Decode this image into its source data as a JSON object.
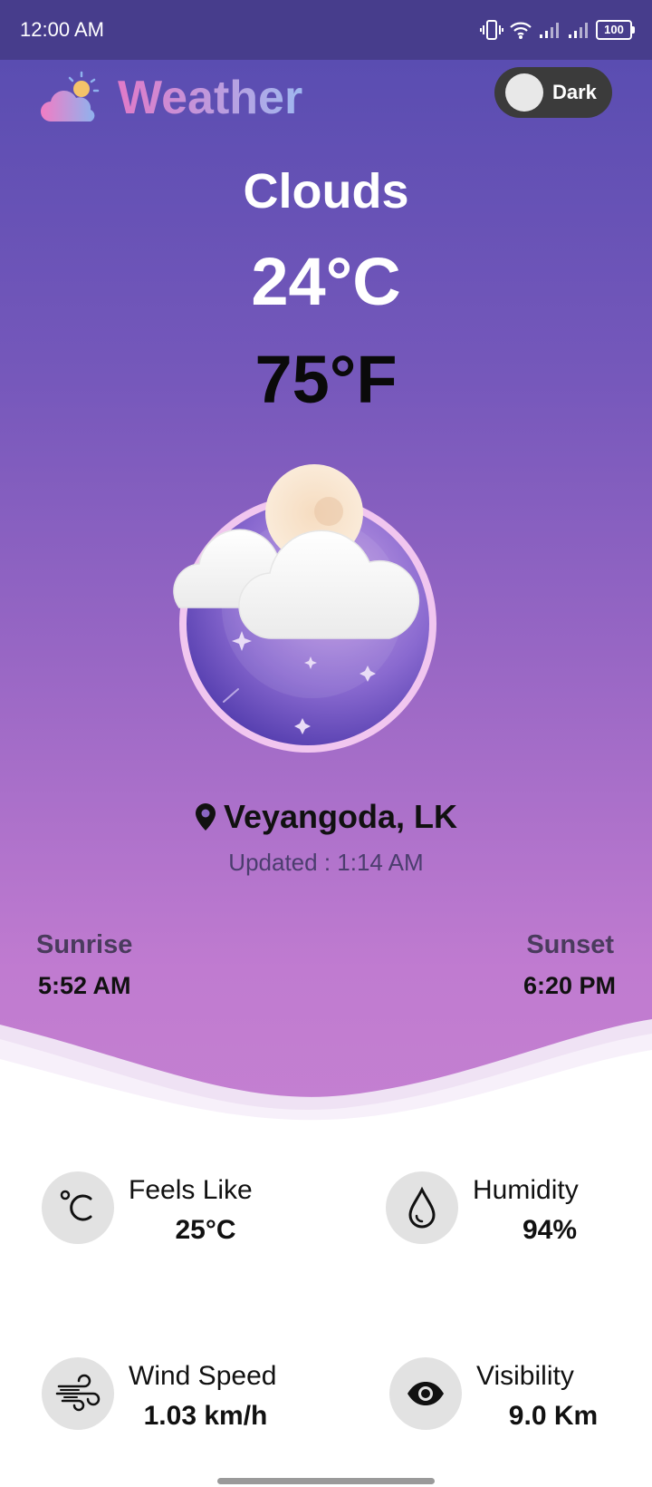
{
  "status_bar": {
    "time": "12:00 AM",
    "battery": "100"
  },
  "app": {
    "title": "Weather",
    "theme_toggle_label": "Dark"
  },
  "current": {
    "condition": "Clouds",
    "temp_c": "24°C",
    "temp_f": "75°F",
    "location": "Veyangoda, LK",
    "updated_label": "Updated :",
    "updated_time": "1:14 AM"
  },
  "sun": {
    "sunrise_label": "Sunrise",
    "sunrise_time": "5:52 AM",
    "sunset_label": "Sunset",
    "sunset_time": "6:20 PM"
  },
  "metrics": {
    "feels_like": {
      "label": "Feels Like",
      "value": "25°C",
      "icon": "celsius-icon"
    },
    "humidity": {
      "label": "Humidity",
      "value": "94%",
      "icon": "droplet-icon"
    },
    "wind_speed": {
      "label": "Wind Speed",
      "value": "1.03 km/h",
      "icon": "wind-icon"
    },
    "visibility": {
      "label": "Visibility",
      "value": "9.0 Km",
      "icon": "eye-icon"
    }
  },
  "colors": {
    "header_bg": "#473d8c",
    "gradient_top": "#5a4db1",
    "gradient_bottom": "#c480d1",
    "title_gradient_start": "#e07ac8",
    "title_gradient_end": "#9fb8f0"
  }
}
